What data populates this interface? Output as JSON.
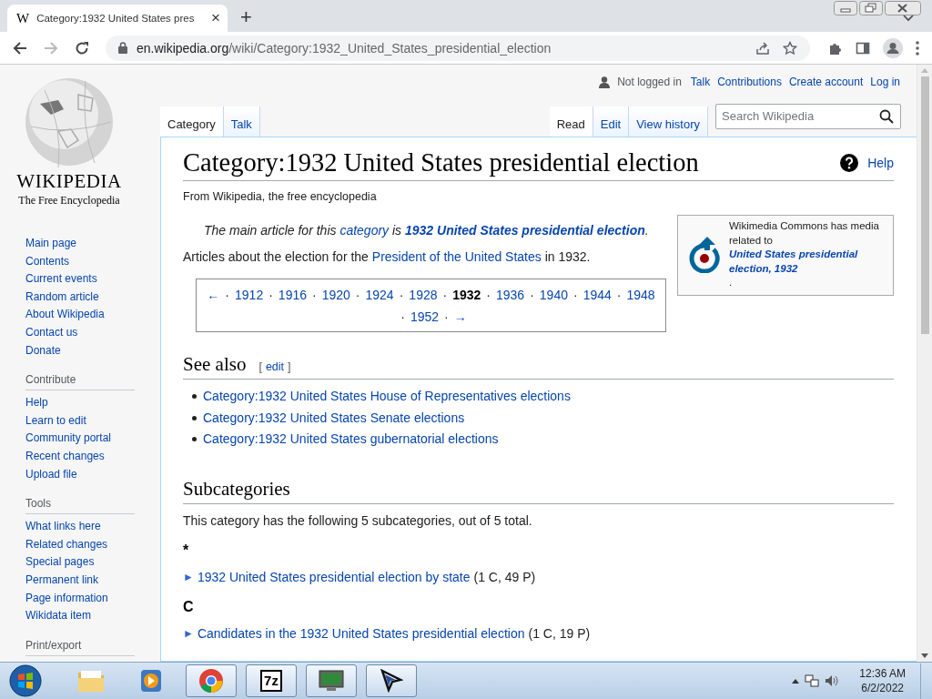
{
  "browser": {
    "tab": {
      "favicon": "W",
      "title": "Category:1932 United States pres",
      "close": "×"
    },
    "new_tab": "+",
    "nav": [
      {
        "kind": "back",
        "disabled": false
      },
      {
        "kind": "forward",
        "disabled": true
      },
      {
        "kind": "reload",
        "disabled": false
      }
    ],
    "address": {
      "domain": "en.wikipedia.org",
      "path": "/wiki/Category:1932_United_States_presidential_election"
    }
  },
  "sidebar": {
    "logo": {
      "wordmark": "WIKIPEDIA",
      "tagline": "The Free Encyclopedia"
    },
    "nav": [
      "Main page",
      "Contents",
      "Current events",
      "Random article",
      "About Wikipedia",
      "Contact us",
      "Donate"
    ],
    "sections": [
      {
        "heading": "Contribute",
        "items": [
          "Help",
          "Learn to edit",
          "Community portal",
          "Recent changes",
          "Upload file"
        ]
      },
      {
        "heading": "Tools",
        "items": [
          "What links here",
          "Related changes",
          "Special pages",
          "Permanent link",
          "Page information",
          "Wikidata item"
        ]
      },
      {
        "heading": "Print/export"
      }
    ]
  },
  "user_links": {
    "status": "Not logged in",
    "links": [
      "Talk",
      "Contributions",
      "Create account",
      "Log in"
    ]
  },
  "tabs_left": [
    {
      "label": "Category",
      "selected": true
    },
    {
      "label": "Talk",
      "selected": false
    }
  ],
  "tabs_right": [
    {
      "label": "Read",
      "selected": true
    },
    {
      "label": "Edit",
      "selected": false
    },
    {
      "label": "View history",
      "selected": false
    }
  ],
  "search": {
    "placeholder": "Search Wikipedia"
  },
  "title": "Category:1932 United States presidential election",
  "help": "Help",
  "tagline": "From Wikipedia, the free encyclopedia",
  "hatnote": [
    {
      "kind": "plain",
      "text": "The main article for this "
    },
    {
      "kind": "link",
      "text": "category"
    },
    {
      "kind": "plain",
      "text": " is "
    },
    {
      "kind": "bold_link",
      "text": "1932 United States presidential election"
    },
    {
      "kind": "plain",
      "text": "."
    }
  ],
  "intro": [
    {
      "kind": "plain",
      "text": "Articles about the election for the "
    },
    {
      "kind": "link",
      "text": "President of the United States"
    },
    {
      "kind": "plain",
      "text": " in 1932."
    }
  ],
  "commons": [
    {
      "kind": "plain",
      "text": "Wikimedia Commons has media related to "
    },
    {
      "kind": "bold_link",
      "text": "United States presidential election, 1932"
    },
    {
      "kind": "plain",
      "text": "."
    }
  ],
  "pager": {
    "separator": "·",
    "items": [
      {
        "label": "←",
        "selected": false
      },
      {
        "label": "1912",
        "selected": false
      },
      {
        "label": "1916",
        "selected": false
      },
      {
        "label": "1920",
        "selected": false
      },
      {
        "label": "1924",
        "selected": false
      },
      {
        "label": "1928",
        "selected": false
      },
      {
        "label": "1932",
        "selected": true
      },
      {
        "label": "1936",
        "selected": false
      },
      {
        "label": "1940",
        "selected": false
      },
      {
        "label": "1944",
        "selected": false
      },
      {
        "label": "1948",
        "selected": false
      },
      {
        "label": "1952",
        "selected": false
      },
      {
        "label": "→",
        "selected": false
      }
    ]
  },
  "see_also": {
    "heading": "See also",
    "edit": {
      "open": "[",
      "label": "edit",
      "close": "]"
    },
    "links": [
      "Category:1932 United States House of Representatives elections",
      "Category:1932 United States Senate elections",
      "Category:1932 United States gubernatorial elections"
    ]
  },
  "subcategories": {
    "heading": "Subcategories",
    "summary": "This category has the following 5 subcategories, out of 5 total.",
    "groups": [
      {
        "letter": "*",
        "items": [
          {
            "toggle": "►",
            "label": "1932 United States presidential election by state",
            "counts": "(1 C, 49 P)"
          }
        ]
      },
      {
        "letter": "C",
        "items": [
          {
            "toggle": "►",
            "label": "Candidates in the 1932 United States presidential election",
            "counts": "(1 C, 19 P)"
          }
        ]
      }
    ]
  },
  "taskbar": {
    "apps": [
      {
        "kind": "folder",
        "running": false
      },
      {
        "kind": "media",
        "running": false
      },
      {
        "kind": "chrome",
        "running": true
      },
      {
        "kind": "zip",
        "running": true,
        "label": "7z"
      },
      {
        "kind": "monitor",
        "running": true
      },
      {
        "kind": "pointer",
        "running": true
      }
    ],
    "time": "12:36 AM",
    "date": "6/2/2022"
  }
}
